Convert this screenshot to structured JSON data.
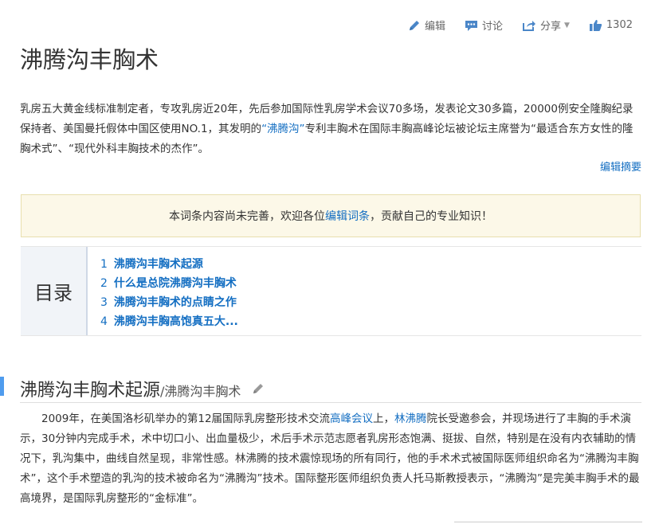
{
  "toolbar": {
    "edit_label": "编辑",
    "discuss_label": "讨论",
    "share_label": "分享",
    "like_count": "1302"
  },
  "page": {
    "title": "沸腾沟丰胸术"
  },
  "summary": {
    "text_a": "乳房五大黄金线标准制定者，专攻乳房近20年，先后参加国际性乳房学术会议70多场，发表论文30多篇，20000例安全隆胸纪录保持者、美国曼托假体中国区使用NO.1，其发明的",
    "link": "“沸腾沟”",
    "text_b": "专利丰胸术在国际丰胸高峰论坛被论坛主席誉为“最适合东方女性的隆胸术式”、“现代外科丰胸技术的杰作”。",
    "edit_summary": "编辑摘要"
  },
  "notice": {
    "text_before": "本词条内容尚未完善，欢迎各位",
    "link": "编辑词条",
    "text_after": "，贡献自己的专业知识！"
  },
  "toc": {
    "heading": "目录",
    "items": [
      {
        "num": "1",
        "label": "沸腾沟丰胸术起源"
      },
      {
        "num": "2",
        "label": "什么是总院沸腾沟丰胸术"
      },
      {
        "num": "3",
        "label": "沸腾沟丰胸术的点睛之作"
      },
      {
        "num": "4",
        "label": "沸腾沟丰胸高饱真五大..."
      }
    ]
  },
  "section1": {
    "title": "沸腾沟丰胸术起源",
    "subtitle": "/沸腾沟丰胸术",
    "p_a": "2009年，在美国洛杉矶举办的第12届国际乳房整形技术交流",
    "link1": "高峰会议",
    "p_b": "上，",
    "link2": "林沸腾",
    "p_c": "院长受邀参会，并现场进行了丰胸的手术演示，30分钟内完成手术，术中切口小、出血量极少，术后手术示范志愿者乳房形态饱满、挺拔、自然，特别是在没有内衣辅助的情况下，乳沟集中，曲线自然呈现，非常性感。林沸腾的技术震惊现场的所有同行，他的手术术式被国际医师组织命名为“沸腾沟丰胸术”，这个手术塑造的乳沟的技术被命名为“沸腾沟”技术。国际整形医师组织负责人托马斯教授表示，“沸腾沟”是完美丰胸手术的最高境界，是国际乳房整形的“金标准”。"
  },
  "colors": {
    "link": "#136ec2",
    "accent_bar": "#4f9cee",
    "notice_bg": "#fcf8e8"
  }
}
